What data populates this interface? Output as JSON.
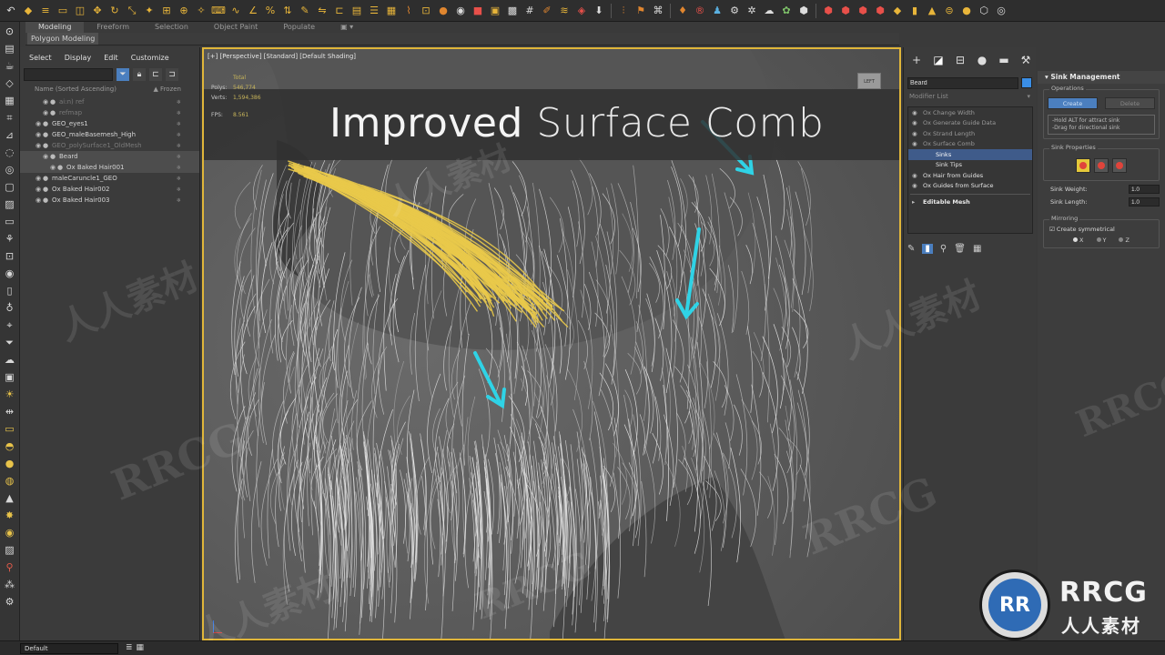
{
  "ribbon": {
    "tabs": [
      "Modeling",
      "Freeform",
      "Selection",
      "Object Paint",
      "Populate"
    ],
    "active_tab": "Modeling",
    "subpanel_label": "Polygon Modeling"
  },
  "scene_explorer": {
    "menu": [
      "Select",
      "Display",
      "Edit",
      "Customize"
    ],
    "header_name": "Name (Sorted Ascending)",
    "header_frozen": "▲ Frozen",
    "items": [
      {
        "label": "ai:n) ref",
        "dim": true,
        "indent": 2
      },
      {
        "label": "refmap",
        "dim": true,
        "indent": 2
      },
      {
        "label": "GEO_eyes1",
        "dim": false,
        "indent": 1
      },
      {
        "label": "GEO_maleBasemesh_High",
        "dim": false,
        "indent": 1
      },
      {
        "label": "GEO_polySurface1_OldMesh",
        "dim": true,
        "indent": 1
      },
      {
        "label": "Beard",
        "dim": false,
        "indent": 2,
        "selected": true
      },
      {
        "label": "Ox Baked Hair001",
        "dim": false,
        "indent": 3,
        "selected": true
      },
      {
        "label": "maleCaruncle1_GEO",
        "dim": false,
        "indent": 1
      },
      {
        "label": "Ox Baked Hair002",
        "dim": false,
        "indent": 1
      },
      {
        "label": "Ox Baked Hair003",
        "dim": false,
        "indent": 1
      }
    ]
  },
  "viewport": {
    "label": "[+] [Perspective] [Standard] [Default Shading]",
    "stats_total": "Total",
    "polys_label": "Polys:",
    "polys_value": "546,774",
    "verts_label": "Verts:",
    "verts_value": "1,594,386",
    "fps_label": "FPS:",
    "fps_value": "8.561",
    "nav_cube_label": "LEFT"
  },
  "title": {
    "bold_word": "Improved",
    "rest": "Surface Comb"
  },
  "command_panel": {
    "object_name": "Beard",
    "modifier_list_label": "Modifier List",
    "stack": [
      {
        "label": "Ox Change Width",
        "on": false
      },
      {
        "label": "Ox Generate Guide Data",
        "on": false
      },
      {
        "label": "Ox Strand Length",
        "on": false
      },
      {
        "label": "Ox Surface Comb",
        "on": false
      },
      {
        "label": "Sinks",
        "on": true,
        "sub": true,
        "highlight": true
      },
      {
        "label": "Sink Tips",
        "on": true,
        "sub": true
      },
      {
        "label": "Ox Hair from Guides",
        "on": true
      },
      {
        "label": "Ox Guides from Surface",
        "on": true
      }
    ],
    "base_object": "Editable Mesh"
  },
  "rollout": {
    "title": "Sink Management",
    "operations_label": "Operations",
    "create_label": "Create",
    "delete_label": "Delete",
    "help_line1": "-Hold ALT for attract sink",
    "help_line2": "-Drag for directional sink",
    "properties_label": "Sink Properties",
    "weight_label": "Sink Weight:",
    "weight_value": "1.0",
    "length_label": "Sink Length:",
    "length_value": "1.0",
    "mirroring_label": "Mirroring",
    "symmetry_label": "Create symmetrical",
    "axes": [
      "X",
      "Y",
      "Z"
    ]
  },
  "bottom": {
    "workspace": "Default"
  },
  "watermarks": {
    "latin": "RRCG",
    "cjk": "人人素材"
  },
  "logo": {
    "badge": "RR",
    "line1": "RRCG",
    "line2": "人人素材"
  },
  "colors": {
    "accent_blue": "#4b7fbf",
    "viewport_border": "#e0b63a",
    "arrow_cyan": "#2fd3e6",
    "hair_yellow": "#e9c94a"
  }
}
